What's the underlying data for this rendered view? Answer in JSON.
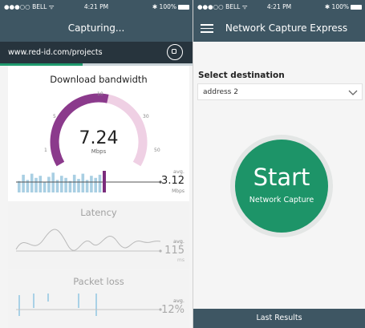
{
  "left_phone": {
    "status": {
      "carrier": "●●●○○ BELL ᯤ",
      "time": "4:21 PM",
      "battery": "100%"
    },
    "header": {
      "title": "Capturing..."
    },
    "url_bar": {
      "url": "www.red-id.com/projects",
      "capture_progress": 0.43
    },
    "download": {
      "title": "Download bandwidth",
      "value": "7.24",
      "unit": "Mbps",
      "gauge_ticks": [
        "1",
        "5",
        "10",
        "30",
        "50"
      ],
      "gauge_fill_fraction": 0.55,
      "history_bars": [
        0.55,
        0.85,
        0.6,
        0.9,
        0.7,
        0.8,
        0.5,
        0.75,
        0.95,
        0.6,
        0.8,
        0.7,
        0.55,
        0.85,
        0.65,
        0.9,
        0.6,
        0.8,
        0.7,
        0.85
      ],
      "avg_label": "avg.",
      "avg_value": "3.12",
      "avg_unit": "Mbps"
    },
    "latency": {
      "title": "Latency",
      "avg_label": "avg.",
      "avg_value": "115",
      "avg_unit": "ms"
    },
    "packet_loss": {
      "title": "Packet loss",
      "avg_label": "avg.",
      "avg_value": "12%"
    }
  },
  "right_phone": {
    "status": {
      "carrier": "●●●○○ BELL ᯤ",
      "time": "4:21 PM",
      "battery": "100%"
    },
    "header": {
      "title": "Network Capture Express"
    },
    "destination": {
      "label": "Select destination",
      "selected": "address 2"
    },
    "start_button": {
      "label": "Start",
      "sublabel": "Network Capture"
    },
    "bottom_tab": {
      "label": "Last Results"
    }
  },
  "colors": {
    "header": "#3e5663",
    "url_bar": "#27343d",
    "accent_green": "#1d9468",
    "gauge_purple": "#8b3a8c",
    "gauge_pink": "#efd0e4",
    "bar_blue": "#a9cfe3"
  }
}
